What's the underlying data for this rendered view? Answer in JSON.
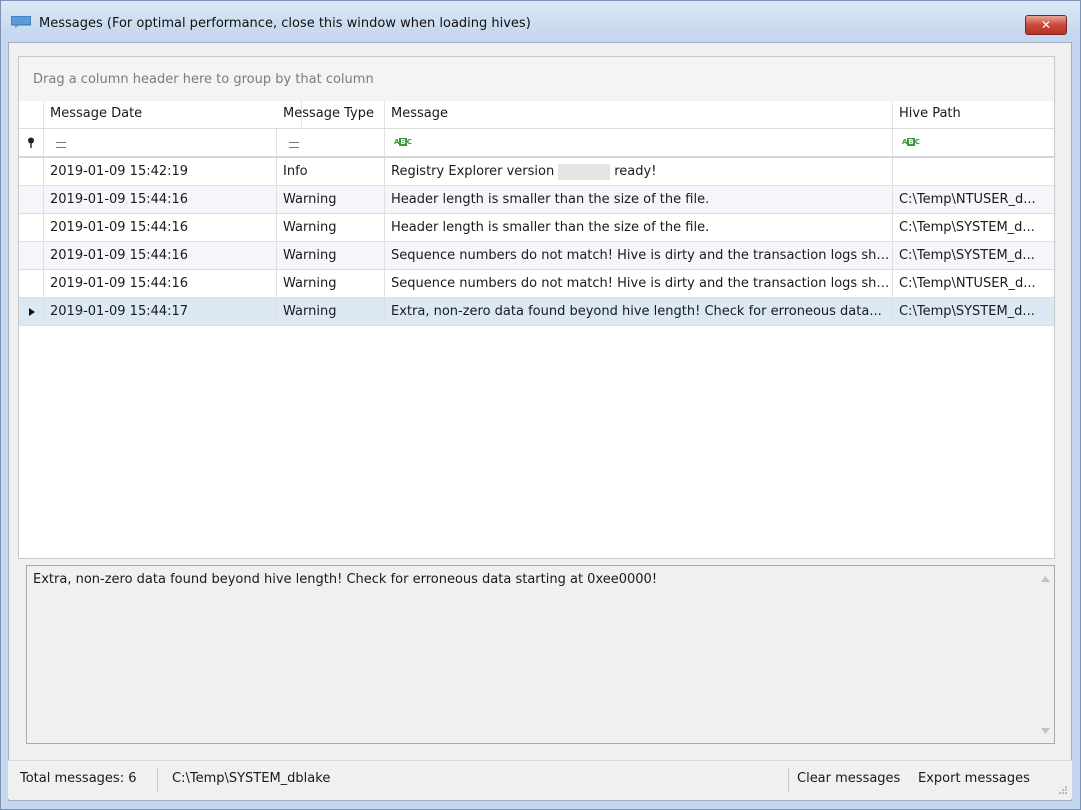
{
  "window": {
    "title": "Messages (For optimal performance, close this window when loading hives)",
    "close_symbol": "✕"
  },
  "grid": {
    "group_panel_hint": "Drag a column header here to group by that column",
    "columns": [
      "Message Date",
      "Message Type",
      "Message",
      "Hive Path"
    ],
    "filter_pin": "📍",
    "rows": [
      {
        "date": "2019-01-09 15:42:19",
        "type": "Info",
        "message_pre": "Registry Explorer version",
        "message_post": "ready!",
        "hive": ""
      },
      {
        "date": "2019-01-09 15:44:16",
        "type": "Warning",
        "message": "Header length is smaller than the size of the file.",
        "hive": "C:\\Temp\\NTUSER_d..."
      },
      {
        "date": "2019-01-09 15:44:16",
        "type": "Warning",
        "message": "Header length is smaller than the size of the file.",
        "hive": "C:\\Temp\\SYSTEM_d..."
      },
      {
        "date": "2019-01-09 15:44:16",
        "type": "Warning",
        "message": "Sequence numbers do not match! Hive is dirty and the transaction logs sho...",
        "hive": "C:\\Temp\\SYSTEM_d..."
      },
      {
        "date": "2019-01-09 15:44:16",
        "type": "Warning",
        "message": "Sequence numbers do not match! Hive is dirty and the transaction logs sho...",
        "hive": "C:\\Temp\\NTUSER_d..."
      },
      {
        "date": "2019-01-09 15:44:17",
        "type": "Warning",
        "message": "Extra, non-zero data found beyond hive length! Check for erroneous data...",
        "hive": "C:\\Temp\\SYSTEM_d..."
      }
    ]
  },
  "detail": {
    "text": "Extra, non-zero data found beyond hive length! Check for erroneous data starting at 0xee0000!"
  },
  "status": {
    "total_messages": "Total messages: 6",
    "current_hive": "C:\\Temp\\SYSTEM_dblake",
    "clear_messages": "Clear messages",
    "export_messages": "Export messages"
  },
  "colors": {
    "title_bar": "#c4d7ee",
    "close_button": "#c9483a",
    "selected_row": "#dce9f5"
  }
}
